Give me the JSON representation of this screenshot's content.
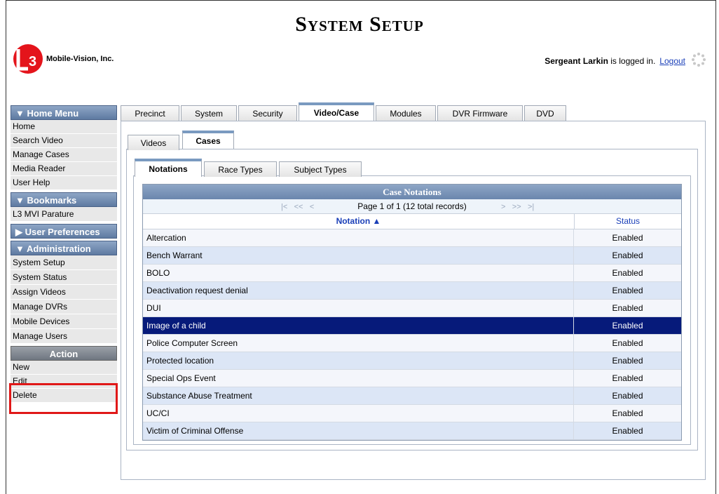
{
  "page_title": "System Setup",
  "company": "Mobile-Vision, Inc.",
  "logo_text": "L3",
  "login": {
    "user": "Sergeant Larkin",
    "suffix": " is logged in.",
    "logout": "Logout"
  },
  "sidebar": {
    "home_menu": {
      "header": "▼  Home Menu",
      "items": [
        "Home",
        "Search Video",
        "Manage Cases",
        "Media Reader",
        "User Help"
      ]
    },
    "bookmarks": {
      "header": "▼  Bookmarks",
      "items": [
        "L3 MVI Parature"
      ]
    },
    "user_prefs": {
      "header": "▶  User Preferences"
    },
    "administration": {
      "header": "▼  Administration",
      "items": [
        "System Setup",
        "System Status",
        "Assign Videos",
        "Manage DVRs",
        "Mobile Devices",
        "Manage Users"
      ]
    },
    "action": {
      "header": "Action",
      "items": [
        "New",
        "Edit",
        "Delete"
      ]
    }
  },
  "tabs_main": [
    "Precinct",
    "System",
    "Security",
    "Video/Case",
    "Modules",
    "DVR Firmware",
    "DVD"
  ],
  "tabs_sub": [
    "Videos",
    "Cases"
  ],
  "tabs_case": [
    "Notations",
    "Race Types",
    "Subject Types"
  ],
  "grid": {
    "title": "Case Notations",
    "pager": "Page 1 of 1 (12 total records)",
    "col_notation": "Notation ▲",
    "col_status": "Status",
    "rows": [
      {
        "n": "Altercation",
        "s": "Enabled"
      },
      {
        "n": "Bench Warrant",
        "s": "Enabled"
      },
      {
        "n": "BOLO",
        "s": "Enabled"
      },
      {
        "n": "Deactivation request denial",
        "s": "Enabled"
      },
      {
        "n": "DUI",
        "s": "Enabled"
      },
      {
        "n": "Image of a child",
        "s": "Enabled"
      },
      {
        "n": "Police Computer Screen",
        "s": "Enabled"
      },
      {
        "n": "Protected location",
        "s": "Enabled"
      },
      {
        "n": "Special Ops Event",
        "s": "Enabled"
      },
      {
        "n": "Substance Abuse Treatment",
        "s": "Enabled"
      },
      {
        "n": "UC/CI",
        "s": "Enabled"
      },
      {
        "n": "Victim of Criminal Offense",
        "s": "Enabled"
      }
    ]
  },
  "colors": {
    "accent": "#5e7aa1",
    "selected_row": "#061a7a",
    "highlight_box": "#e01818"
  }
}
